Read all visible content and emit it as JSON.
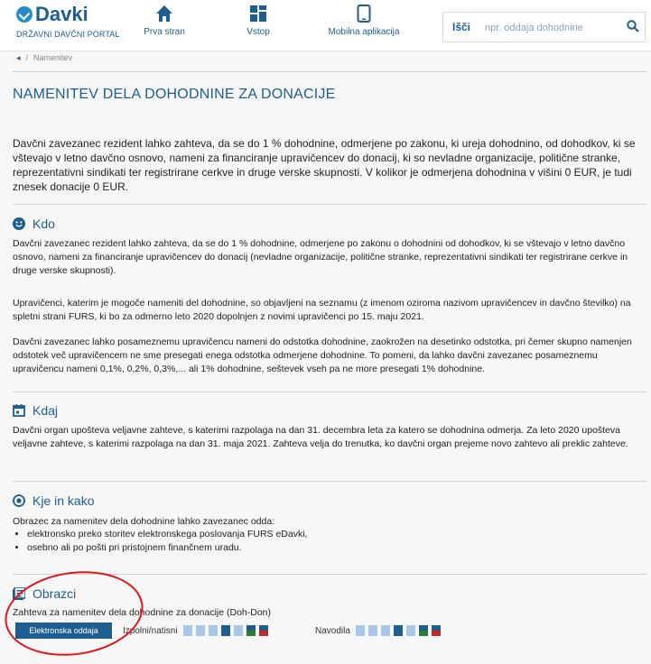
{
  "header": {
    "logo_text": "Davki",
    "logo_subtitle": "DRŽAVNI DAVČNI PORTAL",
    "nav": [
      {
        "label": "Prva stran",
        "icon": "home-icon"
      },
      {
        "label": "Vstop",
        "icon": "login-grid-icon"
      },
      {
        "label": "Mobilna aplikacija",
        "icon": "mobile-phone-icon"
      }
    ],
    "search": {
      "label": "Išči",
      "placeholder": "npr. oddaja dohodnine",
      "icon": "search-icon"
    }
  },
  "breadcrumb": {
    "current": "Namenitev"
  },
  "page_title": "NAMENITEV DELA DOHODNINE ZA DONACIJE",
  "intro": "Davčni zavezanec rezident lahko zahteva, da se do 1 % dohodnine, odmerjene po zakonu, ki ureja dohodnino, od dohodkov, ki se vštevajo v letno davčno osnovo, nameni za financiranje upravičencev do donacij, ki so nevladne organizacije, politične stranke, reprezentativni sindikati ter registrirane cerkve in druge verske skupnosti. V kolikor je odmerjena dohodnina v višini 0 EUR, je tudi znesek donacije 0 EUR.",
  "sections": {
    "kdo": {
      "title": "Kdo",
      "icon": "smiley-icon",
      "p1": "Davčni zavezanec rezident lahko zahteva, da se do 1 % dohodnine, odmerjene po zakonu o dohodnini od dohodkov, ki se vštevajo v letno davčno osnovo, nameni za financiranje upravičencev do donacij (nevladne organizacije, politične stranke, reprezentativni sindikati ter registrirane cerkve in druge verske skupnosti).",
      "p2": "Upravičenci, katerim je mogoče nameniti del dohodnine, so objavljeni na seznamu (z imenom oziroma nazivom upravičencev in davčno številko) na spletni strani FURS, ki bo za odmerno leto 2020 dopolnjen z novimi upravičenci po 15. maju 2021.",
      "p3": "Davčni zavezanec lahko posameznemu upravičencu nameni do odstotka dohodnine, zaokrožen na desetinko odstotka, pri čemer skupno namenjen odstotek več upravičencem ne sme presegati enega odstotka odmerjene dohodnine. To pomeni, da lahko davčni zavezanec posameznemu upravičencu nameni 0,1%, 0,2%, 0,3%,... ali 1% dohodnine, seštevek vseh pa ne more presegati 1% dohodnine."
    },
    "kdaj": {
      "title": "Kdaj",
      "icon": "calendar-icon",
      "p1": "Davčni organ upošteva veljavne zahteve, s katerimi razpolaga na dan 31. decembra leta za katero se dohodnina odmerja. Za leto 2020 upošteva veljavne zahteve, s katerimi razpolaga na dan 31. maja 2021. Zahteva velja do trenutka, ko davčni organ prejeme novo zahtevo ali preklic zahteve."
    },
    "kje": {
      "title": "Kje in kako",
      "icon": "target-icon",
      "p1": "Obrazec za namenitev dela dohodnine lahko zavezanec odda:",
      "items": [
        "elektronsko preko storitev elektronskega poslovanja FURS eDavki,",
        "osebno ali po pošti pri pristojnem finančnem uradu."
      ]
    },
    "obrazci": {
      "title": "Obrazci",
      "icon": "form-list-icon",
      "form_name": "Zahteva za namenitev dela dohodnine za donacije (Doh-Don)",
      "button": "Elektronska oddaja",
      "izpolni_label": "Izpolni/natisni",
      "navodila_label": "Navodila"
    }
  },
  "file_icons": [
    {
      "name": "word-file-icon",
      "color": "#a9c8e8"
    },
    {
      "name": "excel-file-icon",
      "color": "#a9c8e8"
    },
    {
      "name": "text-file-icon",
      "color": "#a9c8e8"
    },
    {
      "name": "pdf-file-icon",
      "color": "#1d5e8f"
    },
    {
      "name": "document-file-icon",
      "color": "#a9c8e8"
    },
    {
      "name": "spreadsheet-file-icon",
      "color": "#2e7d32"
    },
    {
      "name": "pdf-colored-file-icon",
      "color": "#c62828"
    }
  ],
  "annotation": {
    "color": "#e0141b"
  }
}
